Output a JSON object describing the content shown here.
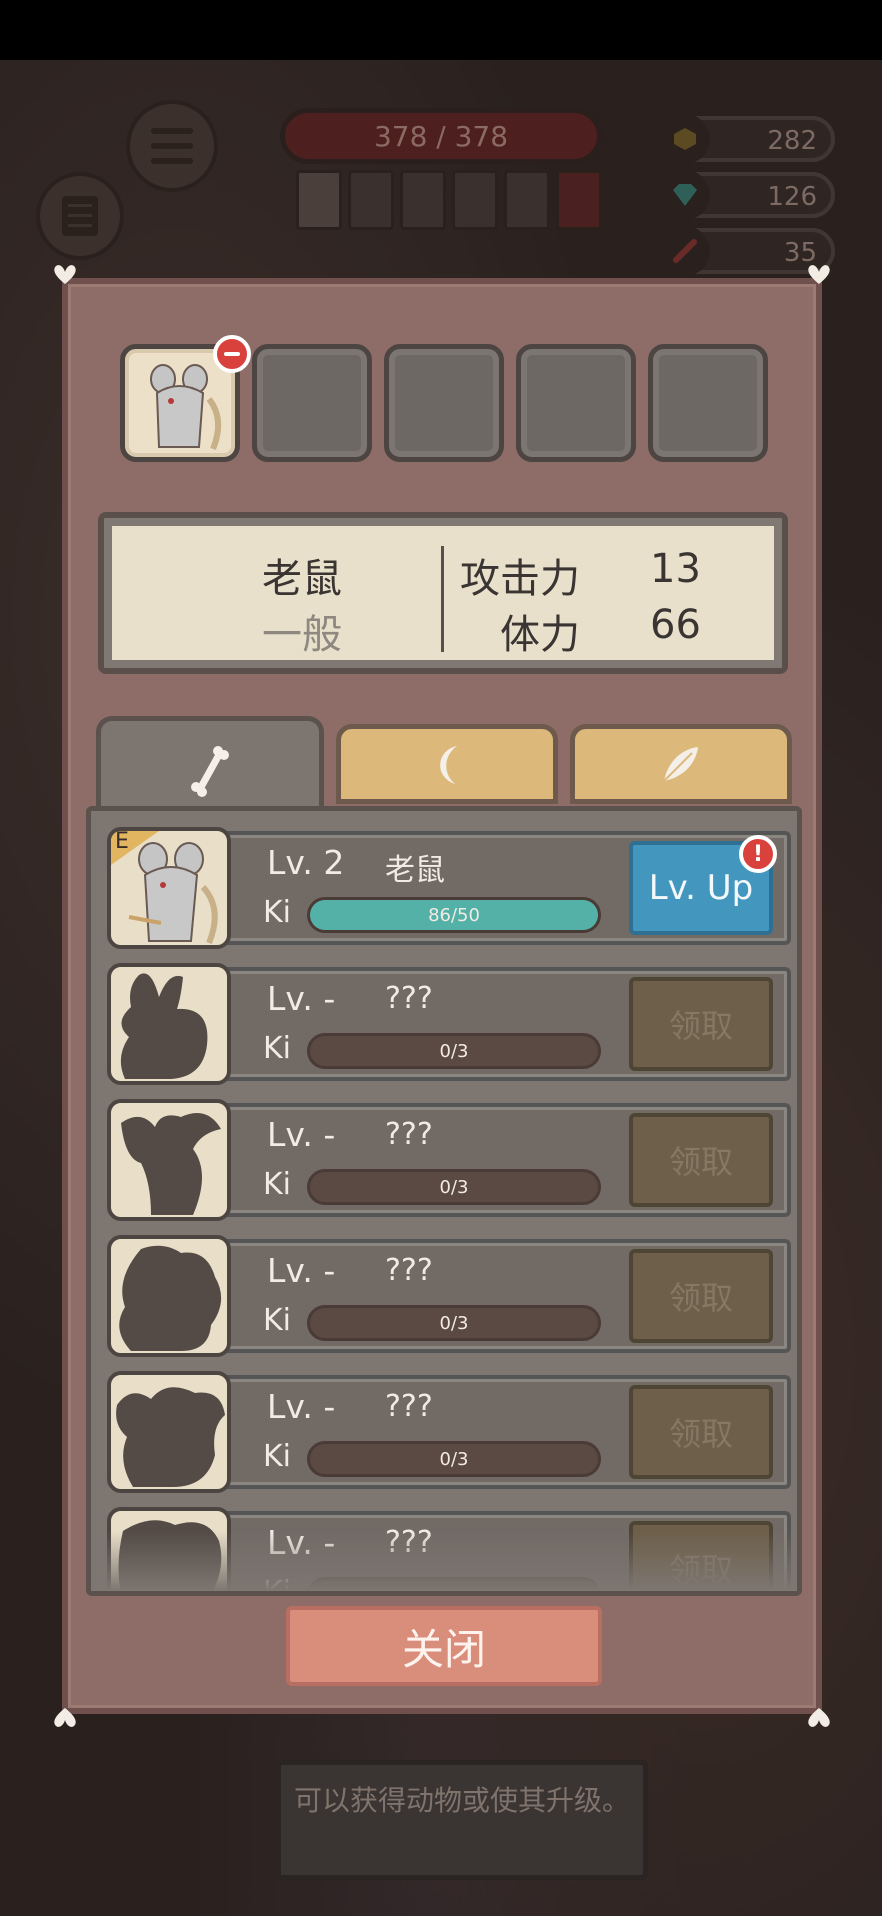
{
  "hud": {
    "hp_text": "378 / 378",
    "currencies": [
      {
        "icon": "gold-coin-icon",
        "value": "282"
      },
      {
        "icon": "gem-icon",
        "value": "126"
      },
      {
        "icon": "bone-icon",
        "value": "35"
      }
    ]
  },
  "modal": {
    "summary": {
      "name": "老鼠",
      "rarity": "一般",
      "attack_label": "攻击力",
      "attack_value": "13",
      "stamina_label": "体力",
      "stamina_value": "66"
    },
    "tabs": [
      {
        "icon": "bone-icon",
        "active": true
      },
      {
        "icon": "claw-icon",
        "active": false
      },
      {
        "icon": "feather-icon",
        "active": false
      }
    ],
    "rows": [
      {
        "rank": "E",
        "level": "Lv. 2",
        "name": "老鼠",
        "ki_label": "Ki",
        "progress_text": "86/50",
        "progress": 1.0,
        "action": "Lv. Up",
        "unlocked": true
      },
      {
        "level": "Lv. -",
        "name": "???",
        "ki_label": "Ki",
        "progress_text": "0/3",
        "progress": 0,
        "action": "领取",
        "unlocked": false
      },
      {
        "level": "Lv. -",
        "name": "???",
        "ki_label": "Ki",
        "progress_text": "0/3",
        "progress": 0,
        "action": "领取",
        "unlocked": false
      },
      {
        "level": "Lv. -",
        "name": "???",
        "ki_label": "Ki",
        "progress_text": "0/3",
        "progress": 0,
        "action": "领取",
        "unlocked": false
      },
      {
        "level": "Lv. -",
        "name": "???",
        "ki_label": "Ki",
        "progress_text": "0/3",
        "progress": 0,
        "action": "领取",
        "unlocked": false
      },
      {
        "level": "Lv. -",
        "name": "???",
        "ki_label": "Ki",
        "progress_text": "",
        "progress": 0,
        "action": "领取",
        "unlocked": false
      }
    ],
    "close_label": "关闭"
  },
  "tooltip": "可以获得动物或使其升级。",
  "colors": {
    "modal_bg": "#8e6d68",
    "progress_fill": "#54b1a7",
    "levelup_button": "#4397be",
    "close_button": "#d98d7b",
    "alert_red": "#d9413d"
  }
}
